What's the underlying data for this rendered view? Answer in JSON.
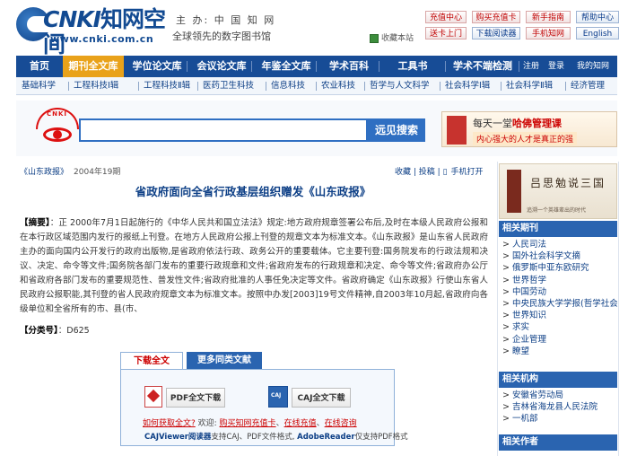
{
  "header": {
    "logo_mark": "CNKI",
    "logo_cn": "知网空间",
    "logo_url": "www.cnki.com.cn",
    "sponsor": "主 办: 中 国 知 网",
    "slogan": "全球领先的数字图书馆",
    "favorite": "收藏本站",
    "buttons": [
      {
        "label": "充值中心"
      },
      {
        "label": "购买充值卡"
      },
      {
        "label": "新手指南"
      },
      {
        "label": "帮助中心"
      },
      {
        "label": "送卡上门"
      },
      {
        "label": "下载阅读器"
      },
      {
        "label": "手机知网"
      },
      {
        "label": "English"
      }
    ]
  },
  "nav": {
    "items": [
      {
        "label": "首页"
      },
      {
        "label": "期刊全文库"
      },
      {
        "label": "学位论文库"
      },
      {
        "label": "会议论文库"
      },
      {
        "label": "年鉴全文库"
      },
      {
        "label": "学术百科"
      },
      {
        "label": "工具书"
      },
      {
        "label": "学术不端检测"
      }
    ],
    "register": "注册",
    "login": "登录",
    "my_cnki": "我的知网"
  },
  "subnav": [
    "基础科学",
    "工程科技Ⅰ辑",
    "工程科技Ⅱ辑",
    "医药卫生科技",
    "信息科技",
    "农业科技",
    "哲学与人文科学",
    "社会科学Ⅰ辑",
    "社会科学Ⅱ辑",
    "经济管理"
  ],
  "search": {
    "icon_label": "CNKI",
    "placeholder": "",
    "button": "远见搜索",
    "promo_line1_pre": "每天一堂",
    "promo_line1_hl": "哈佛管理课",
    "promo_line2": "内心强大的人才是真正的强"
  },
  "article": {
    "journal": "《山东政报》",
    "year_issue": "2004年19期",
    "tools": {
      "favorite": "收藏",
      "submit": "投稿",
      "mobile": "手机打开"
    },
    "title": "省政府面向全省行政基层组织赠发《山东政报》",
    "abstract_label": "【摘要】",
    "abstract": "：正  2000年7月1日起施行的《中华人民共和国立法法》规定:地方政府规章签署公布后,及时在本级人民政府公报和在本行政区域范围内发行的报纸上刊登。在地方人民政府公报上刊登的规章文本为标准文本。《山东政报》是山东省人民政府主办的面向国内公开发行的政府出版物,是省政府依法行政、政务公开的重要载体。它主要刊登:国务院发布的行政法规和决议、决定、命令等文件;国务院各部门发布的重要行政规章和文件;省政府发布的行政规章和决定、命令等文件;省政府办公厅和省政府各部门发布的重要规范性、普发性文件;省政府批准的人事任免决定等文件。省政府确定《山东政报》行使山东省人民政府公报职能,其刊登的省人民政府规章文本为标准文本。按照中办发[2003]19号文件精神,自2003年10月起,省政府向各级单位和全省所有的市、县(市、",
    "class_label": "【分类号】",
    "class_value": "：D625"
  },
  "download": {
    "tab_active": "下载全文",
    "tab_other": "更多同类文献",
    "pdf_btn": "PDF全文下载",
    "caj_btn": "CAJ全文下载",
    "line1_link1": "如何获取全文?",
    "line1_welcome": " 欢迎: ",
    "line1_link2": "购买知网充值卡",
    "line1_sep1": "、",
    "line1_link3": "在线充值",
    "line1_sep2": "、",
    "line1_link4": "在线咨询",
    "line2_b1": "CAJViewer阅读器",
    "line2_t1": "支持CAJ、PDF文件格式, ",
    "line2_b2": "AdobeReader",
    "line2_t2": "仅支持PDF格式"
  },
  "sidebar": {
    "ad_title": "吕思勉说三国",
    "ad_sub": "追溯一个英雄辈出的时代",
    "sections": [
      {
        "title": "相关期刊",
        "items": [
          "人民司法",
          "国外社会科学文摘",
          "俄罗斯中亚东欧研究",
          "世界哲学",
          "中国劳动",
          "中央民族大学学报(哲学社会",
          "世界知识",
          "求实",
          "企业管理",
          "瞭望"
        ]
      },
      {
        "title": "相关机构",
        "items": [
          "安徽省劳动局",
          "吉林省海龙县人民法院",
          "一机部"
        ]
      },
      {
        "title": "相关作者",
        "items": []
      }
    ]
  },
  "colors": {
    "brand_blue": "#174c96",
    "active_tab": "#e9a21a",
    "link_blue": "#0d3f86",
    "accent_red": "#c00000"
  }
}
